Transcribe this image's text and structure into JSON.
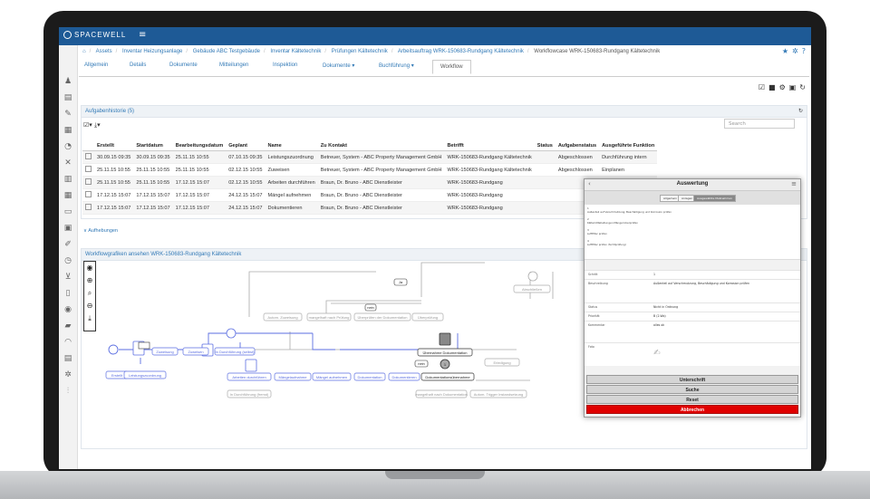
{
  "app": {
    "brand": "SPACEWELL"
  },
  "breadcrumb": [
    "Assets",
    "Inventar Heizungsanlage",
    "Gebäude ABC Testgebäude",
    "Inventar Kältetechnik",
    "Prüfungen Kältetechnik",
    "Arbeitsauftrag WRK-150683-Rundgang Kältetechnik",
    "Workflowcase WRK-150683-Rundgang Kältetechnik"
  ],
  "tabs": [
    "Allgemein",
    "Details",
    "Dokumente",
    "Mitteilungen",
    "Inspektion",
    "Dokumente ▾",
    "Buchführung ▾",
    "Workflow"
  ],
  "history": {
    "title": "Aufgabenhistorie (5)",
    "search_placeholder": "Search",
    "columns": [
      "Erstellt",
      "Startdatum",
      "Bearbeitungsdatum",
      "Geplant",
      "Name",
      "Zu Kontakt",
      "Betrifft",
      "Status",
      "Aufgabenstatus",
      "Ausgeführte Funktion"
    ],
    "rows": [
      [
        "30.09.15 09:35",
        "30.09.15 09:35",
        "25.11.15 10:55",
        "07.10.15 09:35",
        "Leistungszuordnung",
        "Betreuer, System - ABC Property Management GmbH",
        "WRK-150683-Rundgang Kältetechnik",
        "",
        "Abgeschlossen",
        "Durchführung intern"
      ],
      [
        "25.11.15 10:55",
        "25.11.15 10:55",
        "25.11.15 10:55",
        "02.12.15 10:55",
        "Zuweisen",
        "Betreuer, System - ABC Property Management GmbH",
        "WRK-150683-Rundgang Kältetechnik",
        "",
        "Abgeschlossen",
        "Einplanen"
      ],
      [
        "25.11.15 10:55",
        "25.11.15 10:55",
        "17.12.15 15:07",
        "02.12.15 10:55",
        "Arbeiten durchführen",
        "Braun, Dr. Bruno - ABC Dienstleister",
        "WRK-150683-Rundgang",
        "",
        "",
        ""
      ],
      [
        "17.12.15 15:07",
        "17.12.15 15:07",
        "17.12.15 15:07",
        "24.12.15 15:07",
        "Mängel aufnehmen",
        "Braun, Dr. Bruno - ABC Dienstleister",
        "WRK-150683-Rundgang",
        "",
        "",
        ""
      ],
      [
        "17.12.15 15:07",
        "17.12.15 15:07",
        "17.12.15 15:07",
        "24.12.15 15:07",
        "Dokumentieren",
        "Braun, Dr. Bruno - ABC Dienstleister",
        "WRK-150683-Rundgang",
        "",
        "",
        ""
      ]
    ]
  },
  "aufhebungen": "Aufhebungen",
  "workflow": {
    "title": "Workflowgrafiken ansehen WRK-150683-Rundgang Kältetechnik",
    "nodes": {
      "erstellt": "Erstellt",
      "leistungszuordnung": "Leistungszuordnung",
      "zuweisung": "Zuweisung",
      "zuweisen": "Zuweisen",
      "durchf_selbst": "In Durchführung (selbst)",
      "arbeiten": "Arbeiten durchführen",
      "durchf_fremd": "In Durchführung (fremd)",
      "mangelaufnahme": "Mängelaufnahme",
      "maengel": "Mängel aufnehmen",
      "dokumentation": "Dokumentation",
      "dokumentieren": "Dokumentieren",
      "dok_uebernahme": "Dokumentationsübernahme",
      "uebernahme": "Übernahme Dokumentation",
      "autom_zuweisung": "Autom. Zuweisung",
      "maengelfrei": "mangelhaft nach Prüfung",
      "ueberpruefen": "Überprüfen der Dokumentation",
      "ueberpruefung": "Überprüfung",
      "abschliessen": "Abschließen",
      "erledigt": "Erledigung",
      "mangelhaft_dok": "mangelhaft nach Dokumentation",
      "trigger": "Autom. Trigger Instandsetzung",
      "ja": "Ja",
      "nein": "nein",
      "neg": "nein",
      "marker": "1"
    }
  },
  "dialog": {
    "title": "Auswertung",
    "tabs": [
      "Allgemein",
      "Anlagen",
      "Ausgewählte Maßnahmen"
    ],
    "list": [
      {
        "num": "1",
        "text": "Außenteil auf Verschmutzung, Beschädigung und Korrosion prüfen"
      },
      {
        "num": "2",
        "text": "Kältemittelleitungen Mängel überprüfen"
      },
      {
        "num": "3",
        "text": "Luftfilter prüfen"
      },
      {
        "num": "4",
        "text": "Luftfilter prüfen (Sichtprüfung)"
      }
    ],
    "fields": [
      {
        "label": "Schritt",
        "value": "1"
      },
      {
        "label": "Beschreibung",
        "value": "Außenteil auf Verschmutzung, Beschädigung und Korrosion prüfen"
      },
      {
        "label": "Status",
        "value": "Nicht in Ordnung"
      },
      {
        "label": "Priorität",
        "value": "B (2-Wo)"
      },
      {
        "label": "Kommentar",
        "value": "alles ok"
      },
      {
        "label": "Foto",
        "value": ""
      }
    ],
    "buttons": [
      "Unterschrift",
      "Suche",
      "Reset",
      "Abbrechen"
    ],
    "accent_red": "#e00000"
  },
  "colors": {
    "primary": "#1e5a96",
    "link": "#337ab7"
  }
}
